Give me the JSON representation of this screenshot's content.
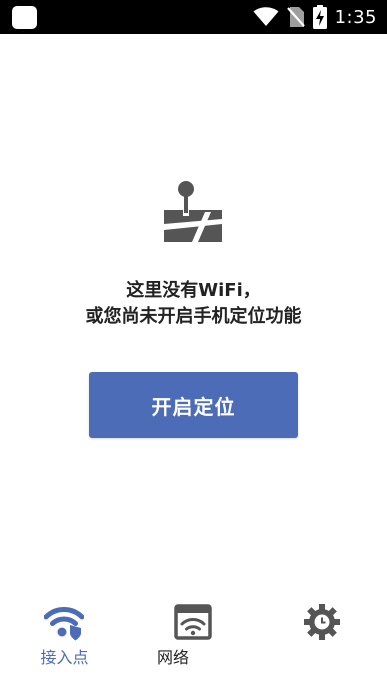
{
  "status_bar": {
    "time": "1:35",
    "icons": [
      "app-notification-icon",
      "wifi-icon",
      "no-sim-icon",
      "battery-charging-icon"
    ],
    "background": "#000000"
  },
  "empty_state": {
    "icon": "map-pin-icon",
    "message_line1": "这里没有WiFi，",
    "message_line2": "或您尚未开启手机定位功能",
    "button_label": "开启定位"
  },
  "bottom_nav": {
    "items": [
      {
        "label": "接入点",
        "icon": "wifi-shield-icon",
        "active": true
      },
      {
        "label": "网络",
        "icon": "network-window-icon",
        "active": false
      },
      {
        "label": "",
        "icon": "settings-gear-icon",
        "active": false
      }
    ]
  },
  "colors": {
    "accent": "#4d6cb7",
    "icon_gray": "#555555",
    "text_dark": "#222222"
  }
}
